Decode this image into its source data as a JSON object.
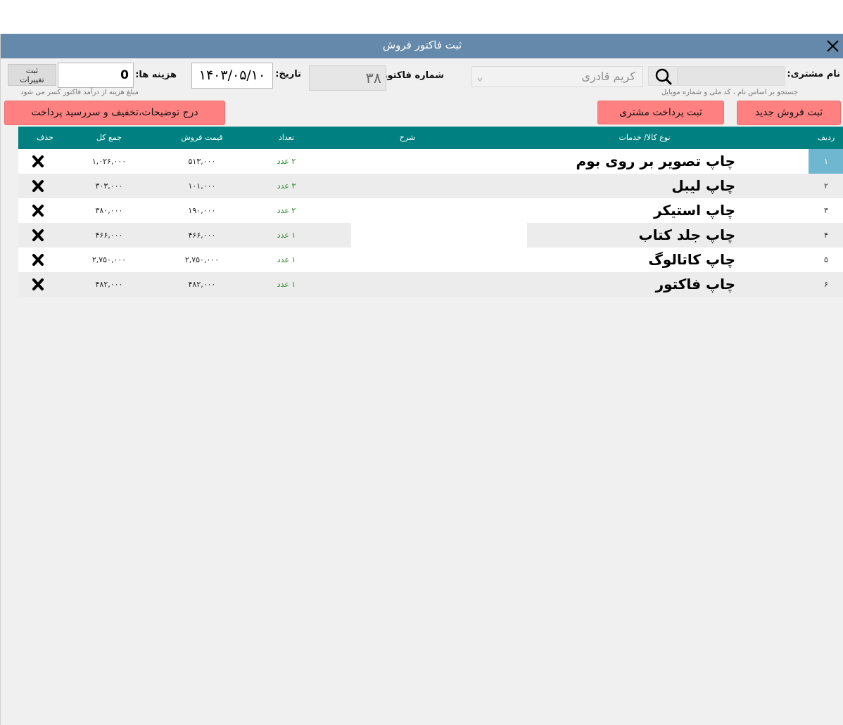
{
  "window": {
    "title": "ثبت فاکتور فروش"
  },
  "customer": {
    "label": "نام مشتری:",
    "search_value": "",
    "selected": "کریم قادری",
    "hint": "جستجو بر اساس نام ، کد ملی و شماره موبایل"
  },
  "invoice": {
    "label": "شماره فاکتور:",
    "value": "۳۸"
  },
  "date": {
    "label": "تاریخ:",
    "value": "۱۴۰۳/۰۵/۱۰"
  },
  "costs": {
    "label": "هزینه ها:",
    "value": "0",
    "save_line1": "ثبت",
    "save_line2": "تغییرات",
    "hint": "مبلغ هزینه از درآمد فاکتور کسر می شود"
  },
  "buttons": {
    "new_sale": "ثبت فروش جدید",
    "customer_payment": "ثبت پرداخت مشتری",
    "description_discount": "درج توضیحات،تخفیف و سررسید پرداخت"
  },
  "table": {
    "headers": {
      "row": "ردیف",
      "item": "نوع کالا/ خدمات",
      "desc": "شرح",
      "qty": "تعداد",
      "price": "قیمت فروش",
      "total": "جمع کل",
      "delete": "حذف"
    },
    "rows": [
      {
        "idx": "۱",
        "name": "چاپ تصویر بر روی بوم",
        "qty": "۲ عدد",
        "price": "۵۱۳,۰۰۰",
        "total": "۱,۰۲۶,۰۰۰"
      },
      {
        "idx": "۲",
        "name": "چاپ لیبل",
        "qty": "۳ عدد",
        "price": "۱۰۱,۰۰۰",
        "total": "۳۰۳,۰۰۰"
      },
      {
        "idx": "۳",
        "name": "چاپ استیکر",
        "qty": "۲ عدد",
        "price": "۱۹۰,۰۰۰",
        "total": "۳۸۰,۰۰۰"
      },
      {
        "idx": "۴",
        "name": "چاپ جلد کتاب",
        "qty": "۱ عدد",
        "price": "۴۶۶,۰۰۰",
        "total": "۴۶۶,۰۰۰"
      },
      {
        "idx": "۵",
        "name": "چاپ کاتالوگ",
        "qty": "۱ عدد",
        "price": "۲,۷۵۰,۰۰۰",
        "total": "۲,۷۵۰,۰۰۰"
      },
      {
        "idx": "۶",
        "name": "چاپ فاکتور",
        "qty": "۱ عدد",
        "price": "۴۸۲,۰۰۰",
        "total": "۴۸۲,۰۰۰"
      }
    ]
  },
  "colors": {
    "titlebar": "#6589ab",
    "header": "#008080",
    "accent_button": "#ff8080",
    "selected_row_index": "#6fb7d1",
    "quantity_text": "#2a8a2a"
  }
}
